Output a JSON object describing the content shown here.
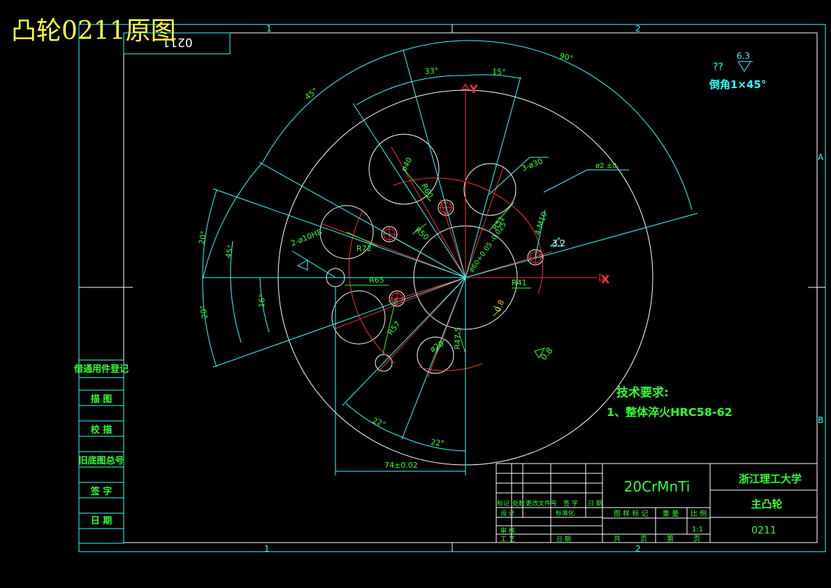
{
  "page_title": "凸轮0211原图",
  "frame": {
    "zone_top_1": "1",
    "zone_top_2": "2",
    "zone_bottom_1": "1",
    "zone_bottom_2": "2",
    "zone_right_a": "A",
    "zone_right_b": "B",
    "corner_code": "0211"
  },
  "axes": {
    "x": "X",
    "y": "Y"
  },
  "dims": {
    "a90": "90°",
    "a45_top": "45°",
    "a33": "33°",
    "a15": "15°",
    "a20_left_top": "20°",
    "a45_left": "45°",
    "a16": "16°",
    "a20_left_bot": "20°",
    "a22_a": "22°",
    "a22_b": "22°",
    "d74": "74±0.02",
    "phi40": "ø40",
    "r60": "R60",
    "n3phi30": "3-ø30",
    "r50": "R50",
    "r72": "R72",
    "r51": "R51",
    "n2phi10": "2-ø10H8",
    "r65": "R65",
    "phi60": "ø60+0.05 -0.025",
    "r41": "R41",
    "m10": "4-M10",
    "r57": "R57",
    "phi20": "ø20",
    "r47": "R47.5",
    "r2": "ø2 ±0."
  },
  "roughness": {
    "top_q": "??",
    "top_val": "6.3",
    "right_val": "3.2",
    "inner_val": "0.8",
    "outer_val": "0.8"
  },
  "chamfer_note": "倒角1×45°",
  "tech": {
    "title": "技术要求:",
    "item1": "1、整体淬火HRC58-62"
  },
  "left_column": [
    "借通用件登记",
    "描  图",
    "校  描",
    "旧底图总号",
    "签  字",
    "日  期"
  ],
  "title_block": {
    "material": "20CrMnTi",
    "school": "浙江理工大学",
    "part_name": "主凸轮",
    "drawing_no": "0211",
    "scale": "1:1",
    "labels": {
      "mark": "标记",
      "count": "处数",
      "change_doc": "更改文件号",
      "sign": "签 字",
      "date": "日 期",
      "design": "设 计",
      "standard": "标准化",
      "review": "审 核",
      "process": "工 艺",
      "date2": "日 期",
      "stage_mark": "图 样 标 记",
      "weight": "重 量",
      "scale_label": "比 例",
      "total": "共",
      "sheet_unit": "页",
      "sheet_no": "第",
      "sheet_unit2": "页"
    }
  },
  "colors": {
    "cyan": "#33ffff",
    "green": "#33ff33",
    "red": "#ff3030",
    "white": "#ffffff",
    "yellow": "#ffff33"
  }
}
